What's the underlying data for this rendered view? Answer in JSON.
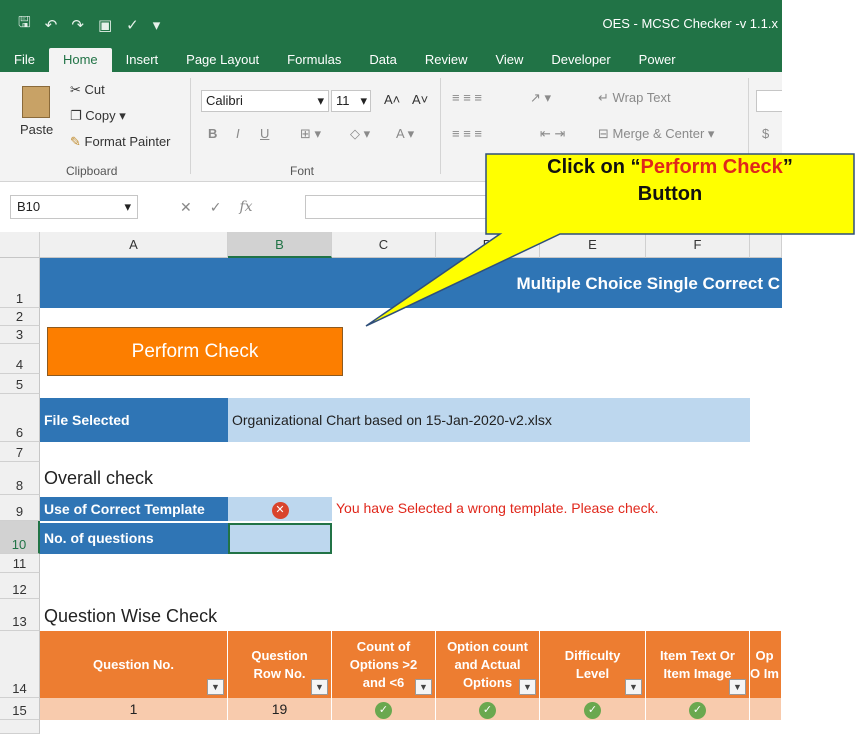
{
  "window": {
    "title": "OES - MCSC Checker -v 1.1.x"
  },
  "ribbon_tabs": [
    "File",
    "Home",
    "Insert",
    "Page Layout",
    "Formulas",
    "Data",
    "Review",
    "View",
    "Developer",
    "Power"
  ],
  "clipboard": {
    "paste": "Paste",
    "cut": "Cut",
    "copy": "Copy",
    "format_painter": "Format Painter",
    "label": "Clipboard"
  },
  "font": {
    "name": "Calibri",
    "size": "11",
    "label": "Font",
    "bold": "B",
    "italic": "I",
    "underline": "U"
  },
  "alignment": {
    "wrap_text": "Wrap Text",
    "merge_center": "Merge & Center"
  },
  "number": {
    "currency": "$"
  },
  "formula_bar": {
    "name_box": "B10",
    "fx": "fx"
  },
  "columns": [
    "A",
    "B",
    "C",
    "D",
    "E",
    "F"
  ],
  "rows": [
    "1",
    "2",
    "3",
    "4",
    "5",
    "6",
    "7",
    "8",
    "9",
    "10",
    "11",
    "12",
    "13",
    "14",
    "15"
  ],
  "sheet": {
    "banner": "Multiple Choice Single Correct C",
    "perform_check_button": "Perform Check",
    "file_selected_label": "File Selected",
    "file_selected_value": "Organizational Chart based on 15-Jan-2020-v2.xlsx",
    "overall_check_heading": "Overall check",
    "correct_template_label": "Use of Correct Template",
    "template_error_message": "You have Selected a wrong template. Please check.",
    "no_questions_label": "No. of questions",
    "question_wise_heading": "Question Wise Check",
    "table_headers": [
      "Question No.",
      "Question Row No.",
      "Count of Options >2 and <6",
      "Option count and Actual Options",
      "Difficulty Level",
      "Item Text Or Item Image",
      "Op O Im"
    ],
    "row15": {
      "question_no": "1",
      "question_row_no": "19"
    }
  },
  "callout": {
    "prefix": "Click on “",
    "highlight": "Perform Check",
    "suffix": "”",
    "line2": "Button"
  },
  "colors": {
    "excel_green": "#217346",
    "banner_blue": "#2f75b5",
    "button_orange": "#fc7e00",
    "header_orange": "#ed7d31",
    "callout_yellow": "#ffff00",
    "error_red": "#e0271b"
  }
}
